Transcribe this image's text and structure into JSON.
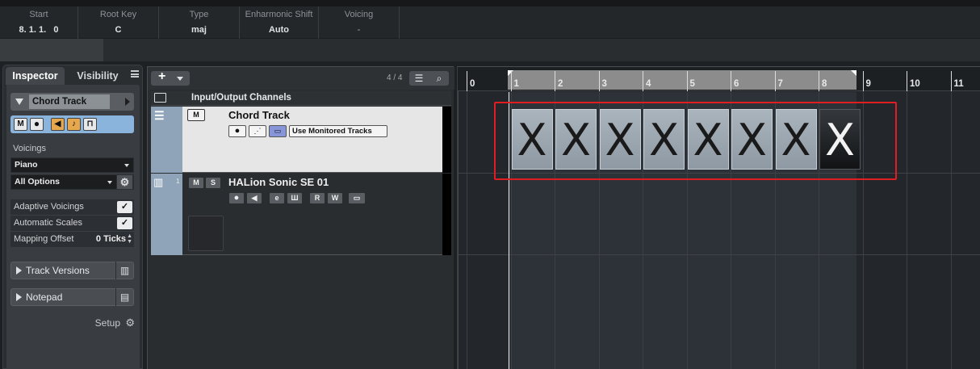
{
  "info_line": {
    "columns": [
      {
        "label": "Start",
        "value": "8. 1. 1.   0"
      },
      {
        "label": "Root Key",
        "value": "C"
      },
      {
        "label": "Type",
        "value": "maj"
      },
      {
        "label": "Enharmonic Shift",
        "value": "Auto"
      },
      {
        "label": "Voicing",
        "value": "-"
      }
    ]
  },
  "inspector": {
    "tabs": [
      "Inspector",
      "Visibility"
    ],
    "track_name": "Chord Track",
    "voicings_label": "Voicings",
    "voicing_preset": "Piano",
    "voicing_options": "All Options",
    "options": [
      {
        "label": "Adaptive Voicings",
        "checked": true
      },
      {
        "label": "Automatic Scales",
        "checked": true
      }
    ],
    "mapping_offset_label": "Mapping Offset",
    "mapping_offset_value": "0 Ticks",
    "sections": [
      "Track Versions",
      "Notepad"
    ],
    "setup_label": "Setup"
  },
  "track_list": {
    "count": "4 / 4",
    "folder_name": "Input/Output Channels",
    "chord_track_name": "Chord Track",
    "monitored_tracks_label": "Use Monitored Tracks",
    "instrument_track_name": "HALion Sonic SE 01",
    "instrument_track_number": "1"
  },
  "arrangement": {
    "bar_numbers": [
      "0",
      "1",
      "2",
      "3",
      "4",
      "5",
      "6",
      "7",
      "8",
      "9",
      "10",
      "11"
    ],
    "chord_events": [
      "X",
      "X",
      "X",
      "X",
      "X",
      "X",
      "X",
      "X"
    ],
    "selected_event_index": 7,
    "highlight_color": "#e01e22"
  }
}
